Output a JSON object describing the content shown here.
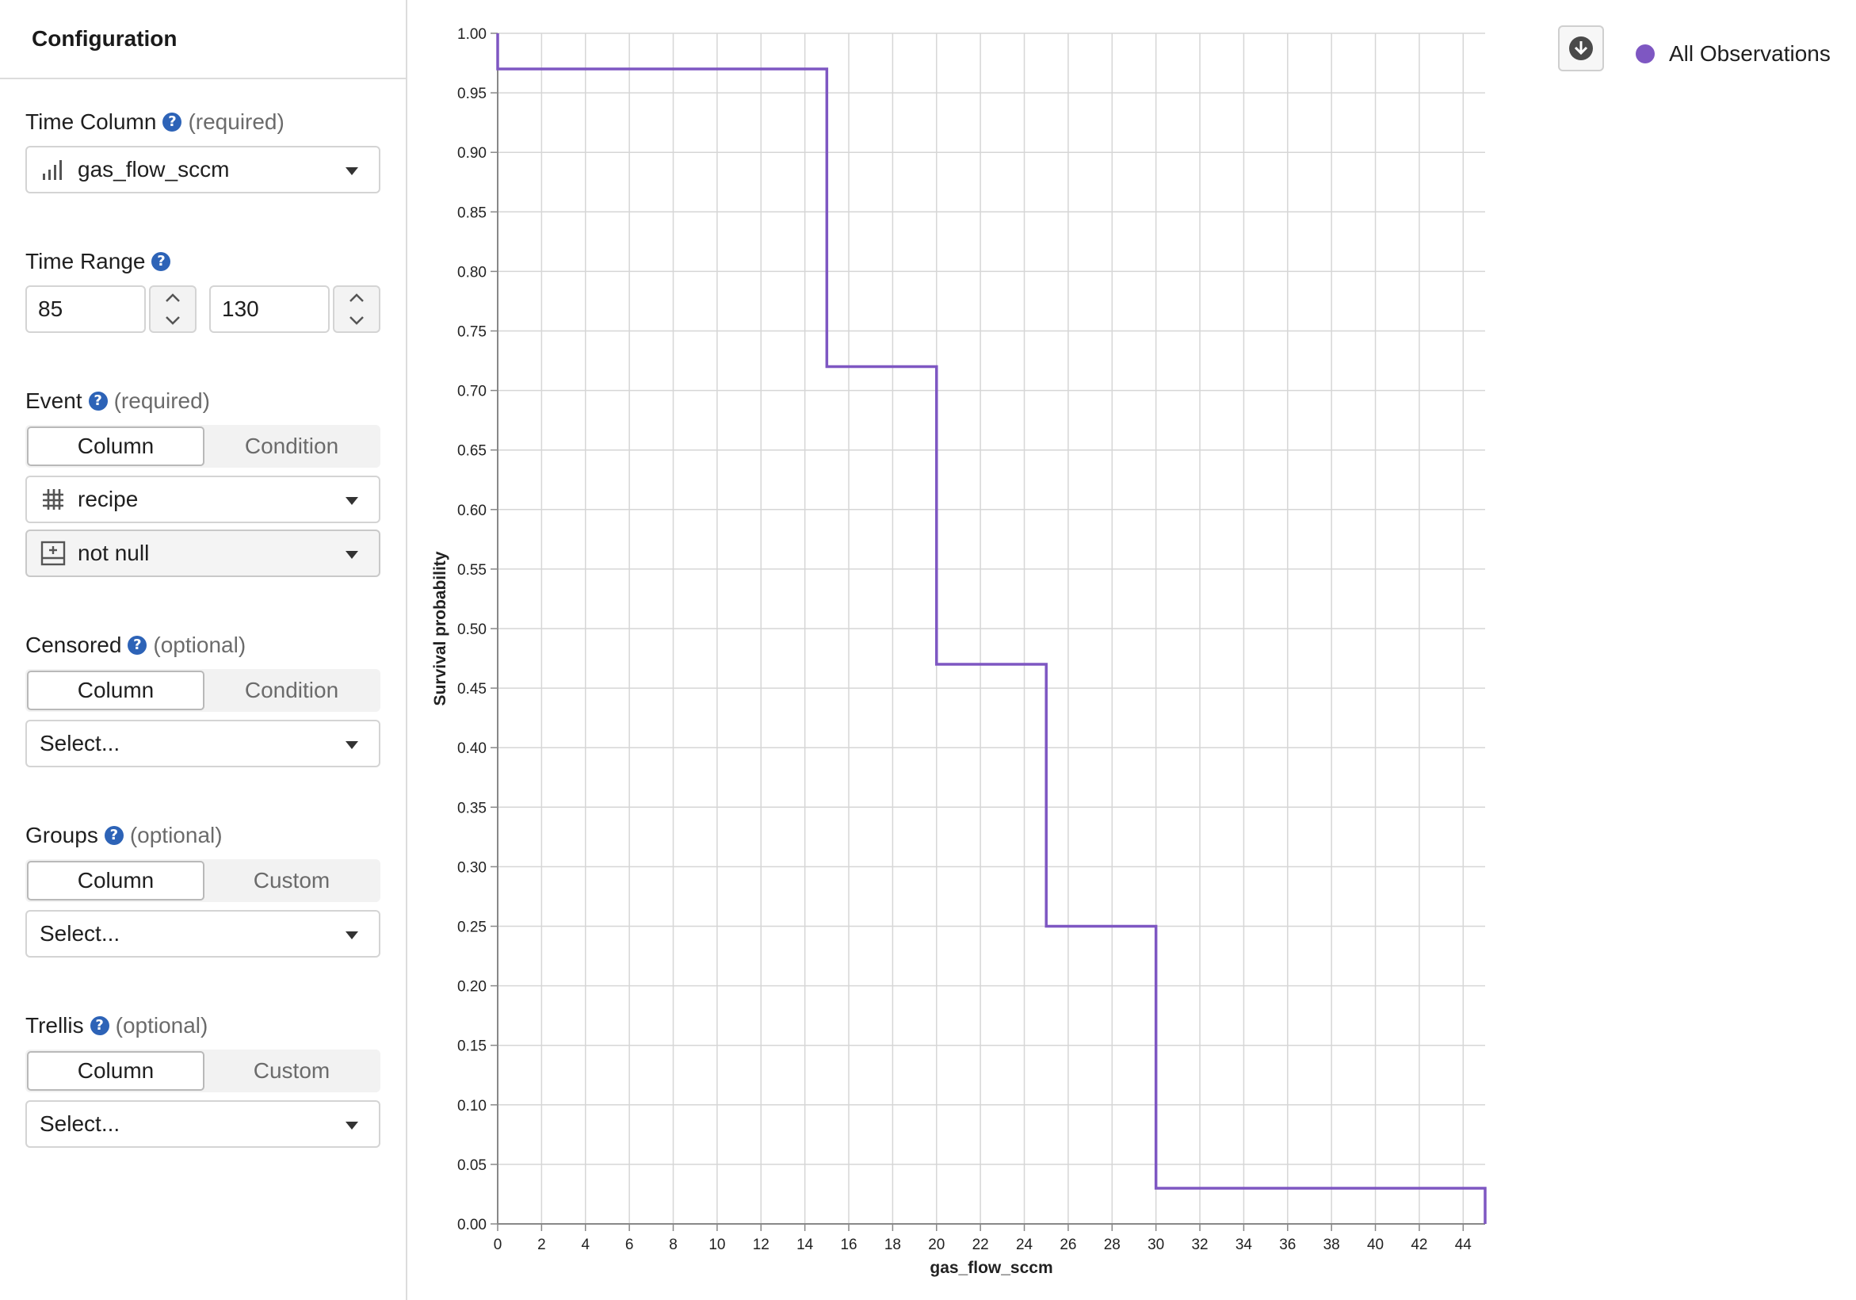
{
  "sidebar": {
    "title": "Configuration",
    "time_column": {
      "label": "Time Column",
      "hint": "(required)",
      "value": "gas_flow_sccm",
      "icon": "bar-chart-icon"
    },
    "time_range": {
      "label": "Time Range",
      "min": "85",
      "max": "130"
    },
    "event": {
      "label": "Event",
      "hint": "(required)",
      "tabs": [
        "Column",
        "Condition"
      ],
      "active_tab": "Column",
      "column_value": "recipe",
      "column_icon": "grid-icon",
      "condition_value": "not null",
      "condition_icon": "plus-box-icon"
    },
    "censored": {
      "label": "Censored",
      "hint": "(optional)",
      "tabs": [
        "Column",
        "Condition"
      ],
      "active_tab": "Column",
      "placeholder": "Select..."
    },
    "groups": {
      "label": "Groups",
      "hint": "(optional)",
      "tabs": [
        "Column",
        "Custom"
      ],
      "active_tab": "Column",
      "placeholder": "Select..."
    },
    "trellis": {
      "label": "Trellis",
      "hint": "(optional)",
      "tabs": [
        "Column",
        "Custom"
      ],
      "active_tab": "Column",
      "placeholder": "Select..."
    }
  },
  "toolbar": {
    "download_icon": "download-icon"
  },
  "colors": {
    "accent": "#7e57c2",
    "help": "#2d63b7",
    "grid": "#d6d6d6"
  },
  "chart_data": {
    "type": "line",
    "step": true,
    "xlabel": "gas_flow_sccm",
    "ylabel": "Survival probability",
    "xlim": [
      0,
      45
    ],
    "ylim": [
      0,
      1
    ],
    "x_ticks": [
      "0",
      "2",
      "4",
      "6",
      "8",
      "10",
      "12",
      "14",
      "16",
      "18",
      "20",
      "22",
      "24",
      "26",
      "28",
      "30",
      "32",
      "34",
      "36",
      "38",
      "40",
      "42",
      "44"
    ],
    "y_ticks": [
      "0.00",
      "0.05",
      "0.10",
      "0.15",
      "0.20",
      "0.25",
      "0.30",
      "0.35",
      "0.40",
      "0.45",
      "0.50",
      "0.55",
      "0.60",
      "0.65",
      "0.70",
      "0.75",
      "0.80",
      "0.85",
      "0.90",
      "0.95",
      "1.00"
    ],
    "grid": true,
    "legend_position": "top-right",
    "series": [
      {
        "name": "All Observations",
        "color": "#7e57c2",
        "x": [
          0,
          15,
          20,
          25,
          30,
          45
        ],
        "y": [
          0.97,
          0.72,
          0.47,
          0.25,
          0.03,
          0.0
        ]
      }
    ]
  }
}
